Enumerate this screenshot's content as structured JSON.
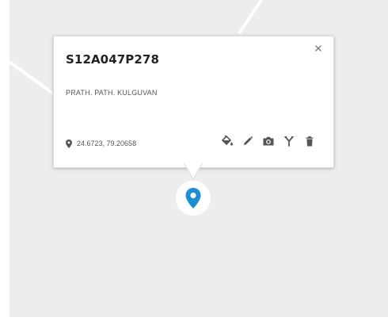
{
  "popup": {
    "title": "S12A047P278",
    "subtitle": "PRATH. PATH. KULGUVAN",
    "coordinates": "24.6723, 79.20658",
    "close_label": "×"
  },
  "icons": {
    "close": "close-icon",
    "location": "location-pin-icon",
    "fill": "paint-bucket-icon",
    "edit": "pencil-icon",
    "camera": "camera-icon",
    "route": "fork-icon",
    "delete": "trash-icon",
    "marker": "map-marker-icon"
  },
  "colors": {
    "map_background": "#ededed",
    "road": "#ffffff",
    "marker": "#1a8fd6",
    "icon": "#555555"
  }
}
